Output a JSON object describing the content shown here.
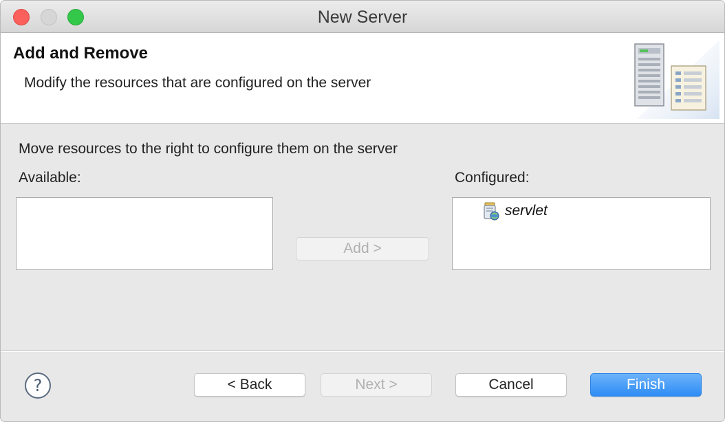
{
  "window": {
    "title": "New Server"
  },
  "banner": {
    "title": "Add and Remove",
    "description": "Modify the resources that are configured on the server",
    "graphic_icon": "server-wizard-icon"
  },
  "content": {
    "instruction": "Move resources to the right to configure them on the server",
    "available_label": "Available:",
    "available_items": [],
    "configured_label": "Configured:",
    "configured_items": [
      {
        "label": "servlet",
        "icon": "web-module-icon"
      }
    ],
    "add_button": {
      "label": "Add >",
      "enabled": false
    }
  },
  "footer": {
    "help_icon": "help-icon",
    "back_label": "< Back",
    "next_label": "Next >",
    "next_enabled": false,
    "cancel_label": "Cancel",
    "finish_label": "Finish"
  },
  "colors": {
    "close": "#fc605c",
    "minimize": "#d6d6d6",
    "zoom": "#34c84a",
    "default_button": "#2e8cf5"
  }
}
